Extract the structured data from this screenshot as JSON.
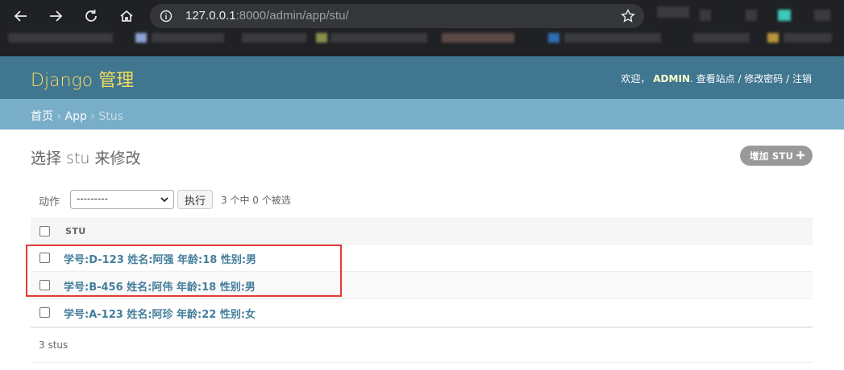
{
  "browser": {
    "url_host": "127.0.0.1",
    "url_path": ":8000/admin/app/stu/",
    "back_icon": "arrow-left-icon",
    "forward_icon": "arrow-right-icon",
    "reload_icon": "reload-icon",
    "home_icon": "home-icon",
    "star_icon": "star-icon",
    "info_icon": "info-icon",
    "colors": {
      "chrome_bg": "#202124",
      "omnibox_bg": "#35363a"
    }
  },
  "header": {
    "brand": "Django 管理",
    "welcome": "欢迎，",
    "username": "ADMIN",
    "dot": ".",
    "view_site": "查看站点",
    "sep1": " / ",
    "change_password": "修改密码",
    "sep2": " / ",
    "logout": "注销",
    "colors": {
      "header_bg": "#417690",
      "brand": "#f5dd5d",
      "breadcrumbs_bg": "#79aec8"
    }
  },
  "breadcrumbs": {
    "home": "首页",
    "sep": " › ",
    "app": "App",
    "current": "Stus"
  },
  "main": {
    "title": "选择 stu 来修改",
    "add_button": "增加 STU",
    "add_icon": "plus-icon",
    "actions": {
      "label": "动作",
      "selected": "---------",
      "go_button": "执行",
      "counter": "3 个中 0 个被选"
    },
    "table": {
      "column_header": "STU",
      "rows": [
        {
          "label": "学号:D-123 姓名:阿强 年龄:18 性别:男"
        },
        {
          "label": "学号:B-456 姓名:阿伟 年龄:18 性别:男"
        },
        {
          "label": "学号:A-123 姓名:阿珍 年龄:22 性别:女"
        }
      ]
    },
    "paginator": "3 stus",
    "link_color": "#447e9b",
    "highlight_color": "#e53935"
  }
}
